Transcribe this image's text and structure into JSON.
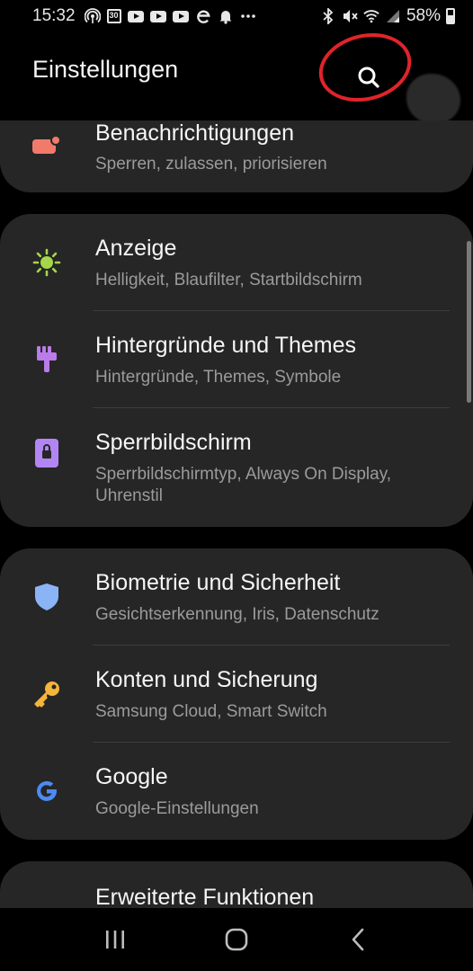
{
  "status_bar": {
    "time": "15:32",
    "battery": "58%",
    "calendar_day": "30",
    "icons": [
      "hotspot-icon",
      "calendar-icon",
      "youtube-icon",
      "youtube-icon",
      "youtube-icon",
      "e-icon",
      "bell-icon",
      "more-icon",
      "bluetooth-icon",
      "mute-icon",
      "wifi-icon",
      "signal-icon",
      "battery-icon"
    ]
  },
  "header": {
    "title": "Einstellungen",
    "search_icon": "search-icon"
  },
  "colors": {
    "annotation": "#e0242a",
    "card_bg": "#262626",
    "notifications": "#f27a6b",
    "display": "#a6d64a",
    "wallpapers": "#b97ce8",
    "lockscreen": "#b286f2",
    "biometrics": "#8ab4f5",
    "accounts": "#f5b43a",
    "google": "#4c8bf5"
  },
  "settings": {
    "notifications": {
      "label": "Benachrichtigungen",
      "sub": "Sperren, zulassen, priorisieren",
      "icon": "notifications-icon"
    },
    "display": {
      "label": "Anzeige",
      "sub": "Helligkeit, Blaufilter, Startbildschirm",
      "icon": "sun-icon"
    },
    "wallpapers": {
      "label": "Hintergründe und Themes",
      "sub": "Hintergründe, Themes, Symbole",
      "icon": "paintbrush-icon"
    },
    "lockscreen": {
      "label": "Sperrbildschirm",
      "sub": "Sperrbildschirmtyp, Always On Display, Uhrenstil",
      "icon": "lock-icon"
    },
    "biometrics": {
      "label": "Biometrie und Sicherheit",
      "sub": "Gesichtserkennung, Iris, Datenschutz",
      "icon": "shield-icon"
    },
    "accounts": {
      "label": "Konten und Sicherung",
      "sub": "Samsung Cloud, Smart Switch",
      "icon": "key-icon"
    },
    "google": {
      "label": "Google",
      "sub": "Google-Einstellungen",
      "icon": "google-icon"
    },
    "advanced": {
      "label": "Erweiterte Funktionen",
      "icon": "advanced-features-icon"
    }
  },
  "navbar": {
    "recents": "recents-icon",
    "home": "home-icon",
    "back": "back-icon"
  }
}
